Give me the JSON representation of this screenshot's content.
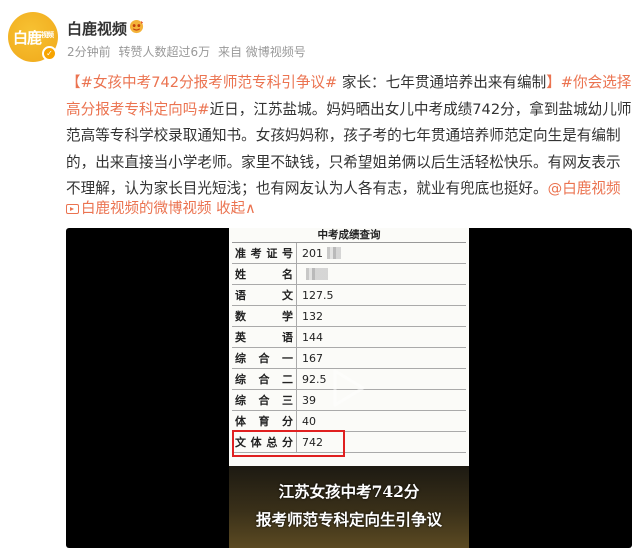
{
  "account": {
    "name": "白鹿视频",
    "avatar_text": "白鹿",
    "avatar_sup": "视频",
    "verified_icon": "verified-v-icon"
  },
  "meta": {
    "time": "2分钟前",
    "reposts": "转赞人数超过6万",
    "source": "来自 微博视频号"
  },
  "post": {
    "bracket_open": "【",
    "tag1": "#女孩中考742分报考师范专科引争议#",
    "headline": " 家长：七年贯通培养出来有编制",
    "bracket_close": "】",
    "tag2": "#你会选择高分报考专科定向吗#",
    "body": "近日，江苏盐城。妈妈晒出女儿中考成绩742分，拿到盐城幼儿师范高等专科学校录取通知书。女孩妈妈称，孩子考的七年贯通培养师范定向生是有编制的，出来直接当小学老师。家里不缺钱，只希望姐弟俩以后生活轻松快乐。有网友表示不理解，认为家长目光短浅；也有网友认为人各有志，就业有兜底也挺好。",
    "mention": "@白鹿视频"
  },
  "video_link": {
    "label": "白鹿视频的微博视频",
    "collapse": "收起",
    "collapse_icon": "∧"
  },
  "video": {
    "table_title": "中考成绩查询",
    "rows": [
      {
        "label": [
          "准",
          "考",
          "证",
          "号"
        ],
        "value": "201",
        "blur": "blur"
      },
      {
        "label": [
          "姓",
          "名"
        ],
        "value": "",
        "blur": "blur2"
      },
      {
        "label": [
          "语",
          "文"
        ],
        "value": "127.5"
      },
      {
        "label": [
          "数",
          "学"
        ],
        "value": "132"
      },
      {
        "label": [
          "英",
          "语"
        ],
        "value": "144"
      },
      {
        "label": [
          "综",
          "合",
          "一"
        ],
        "value": "167"
      },
      {
        "label": [
          "综",
          "合",
          "二"
        ],
        "value": "92.5"
      },
      {
        "label": [
          "综",
          "合",
          "三"
        ],
        "value": "39"
      },
      {
        "label": [
          "体",
          "育",
          "分"
        ],
        "value": "40"
      },
      {
        "label": [
          "文",
          "体",
          "总",
          "分"
        ],
        "value": "742"
      }
    ],
    "banner_line1": "江苏女孩中考742分",
    "banner_line2": "报考师范专科定向生引争议",
    "highlight_color": "#e02020"
  },
  "colors": {
    "link": "#eb7350",
    "text": "#333333",
    "meta": "#999999",
    "avatar": "#f0a81a"
  }
}
